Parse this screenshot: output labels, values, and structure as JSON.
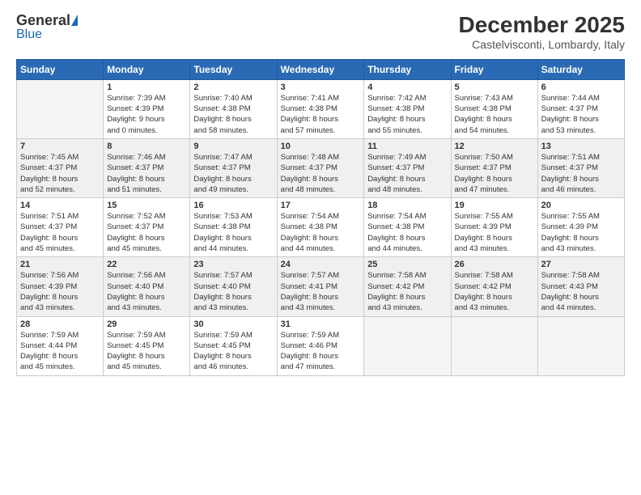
{
  "logo": {
    "general": "General",
    "blue": "Blue"
  },
  "title": "December 2025",
  "subtitle": "Castelvisconti, Lombardy, Italy",
  "days_header": [
    "Sunday",
    "Monday",
    "Tuesday",
    "Wednesday",
    "Thursday",
    "Friday",
    "Saturday"
  ],
  "weeks": [
    {
      "shaded": false,
      "days": [
        {
          "num": "",
          "info": ""
        },
        {
          "num": "1",
          "info": "Sunrise: 7:39 AM\nSunset: 4:39 PM\nDaylight: 9 hours\nand 0 minutes."
        },
        {
          "num": "2",
          "info": "Sunrise: 7:40 AM\nSunset: 4:38 PM\nDaylight: 8 hours\nand 58 minutes."
        },
        {
          "num": "3",
          "info": "Sunrise: 7:41 AM\nSunset: 4:38 PM\nDaylight: 8 hours\nand 57 minutes."
        },
        {
          "num": "4",
          "info": "Sunrise: 7:42 AM\nSunset: 4:38 PM\nDaylight: 8 hours\nand 55 minutes."
        },
        {
          "num": "5",
          "info": "Sunrise: 7:43 AM\nSunset: 4:38 PM\nDaylight: 8 hours\nand 54 minutes."
        },
        {
          "num": "6",
          "info": "Sunrise: 7:44 AM\nSunset: 4:37 PM\nDaylight: 8 hours\nand 53 minutes."
        }
      ]
    },
    {
      "shaded": true,
      "days": [
        {
          "num": "7",
          "info": "Sunrise: 7:45 AM\nSunset: 4:37 PM\nDaylight: 8 hours\nand 52 minutes."
        },
        {
          "num": "8",
          "info": "Sunrise: 7:46 AM\nSunset: 4:37 PM\nDaylight: 8 hours\nand 51 minutes."
        },
        {
          "num": "9",
          "info": "Sunrise: 7:47 AM\nSunset: 4:37 PM\nDaylight: 8 hours\nand 49 minutes."
        },
        {
          "num": "10",
          "info": "Sunrise: 7:48 AM\nSunset: 4:37 PM\nDaylight: 8 hours\nand 48 minutes."
        },
        {
          "num": "11",
          "info": "Sunrise: 7:49 AM\nSunset: 4:37 PM\nDaylight: 8 hours\nand 48 minutes."
        },
        {
          "num": "12",
          "info": "Sunrise: 7:50 AM\nSunset: 4:37 PM\nDaylight: 8 hours\nand 47 minutes."
        },
        {
          "num": "13",
          "info": "Sunrise: 7:51 AM\nSunset: 4:37 PM\nDaylight: 8 hours\nand 46 minutes."
        }
      ]
    },
    {
      "shaded": false,
      "days": [
        {
          "num": "14",
          "info": "Sunrise: 7:51 AM\nSunset: 4:37 PM\nDaylight: 8 hours\nand 45 minutes."
        },
        {
          "num": "15",
          "info": "Sunrise: 7:52 AM\nSunset: 4:37 PM\nDaylight: 8 hours\nand 45 minutes."
        },
        {
          "num": "16",
          "info": "Sunrise: 7:53 AM\nSunset: 4:38 PM\nDaylight: 8 hours\nand 44 minutes."
        },
        {
          "num": "17",
          "info": "Sunrise: 7:54 AM\nSunset: 4:38 PM\nDaylight: 8 hours\nand 44 minutes."
        },
        {
          "num": "18",
          "info": "Sunrise: 7:54 AM\nSunset: 4:38 PM\nDaylight: 8 hours\nand 44 minutes."
        },
        {
          "num": "19",
          "info": "Sunrise: 7:55 AM\nSunset: 4:39 PM\nDaylight: 8 hours\nand 43 minutes."
        },
        {
          "num": "20",
          "info": "Sunrise: 7:55 AM\nSunset: 4:39 PM\nDaylight: 8 hours\nand 43 minutes."
        }
      ]
    },
    {
      "shaded": true,
      "days": [
        {
          "num": "21",
          "info": "Sunrise: 7:56 AM\nSunset: 4:39 PM\nDaylight: 8 hours\nand 43 minutes."
        },
        {
          "num": "22",
          "info": "Sunrise: 7:56 AM\nSunset: 4:40 PM\nDaylight: 8 hours\nand 43 minutes."
        },
        {
          "num": "23",
          "info": "Sunrise: 7:57 AM\nSunset: 4:40 PM\nDaylight: 8 hours\nand 43 minutes."
        },
        {
          "num": "24",
          "info": "Sunrise: 7:57 AM\nSunset: 4:41 PM\nDaylight: 8 hours\nand 43 minutes."
        },
        {
          "num": "25",
          "info": "Sunrise: 7:58 AM\nSunset: 4:42 PM\nDaylight: 8 hours\nand 43 minutes."
        },
        {
          "num": "26",
          "info": "Sunrise: 7:58 AM\nSunset: 4:42 PM\nDaylight: 8 hours\nand 43 minutes."
        },
        {
          "num": "27",
          "info": "Sunrise: 7:58 AM\nSunset: 4:43 PM\nDaylight: 8 hours\nand 44 minutes."
        }
      ]
    },
    {
      "shaded": false,
      "days": [
        {
          "num": "28",
          "info": "Sunrise: 7:59 AM\nSunset: 4:44 PM\nDaylight: 8 hours\nand 45 minutes."
        },
        {
          "num": "29",
          "info": "Sunrise: 7:59 AM\nSunset: 4:45 PM\nDaylight: 8 hours\nand 45 minutes."
        },
        {
          "num": "30",
          "info": "Sunrise: 7:59 AM\nSunset: 4:45 PM\nDaylight: 8 hours\nand 46 minutes."
        },
        {
          "num": "31",
          "info": "Sunrise: 7:59 AM\nSunset: 4:46 PM\nDaylight: 8 hours\nand 47 minutes."
        },
        {
          "num": "",
          "info": ""
        },
        {
          "num": "",
          "info": ""
        },
        {
          "num": "",
          "info": ""
        }
      ]
    }
  ]
}
